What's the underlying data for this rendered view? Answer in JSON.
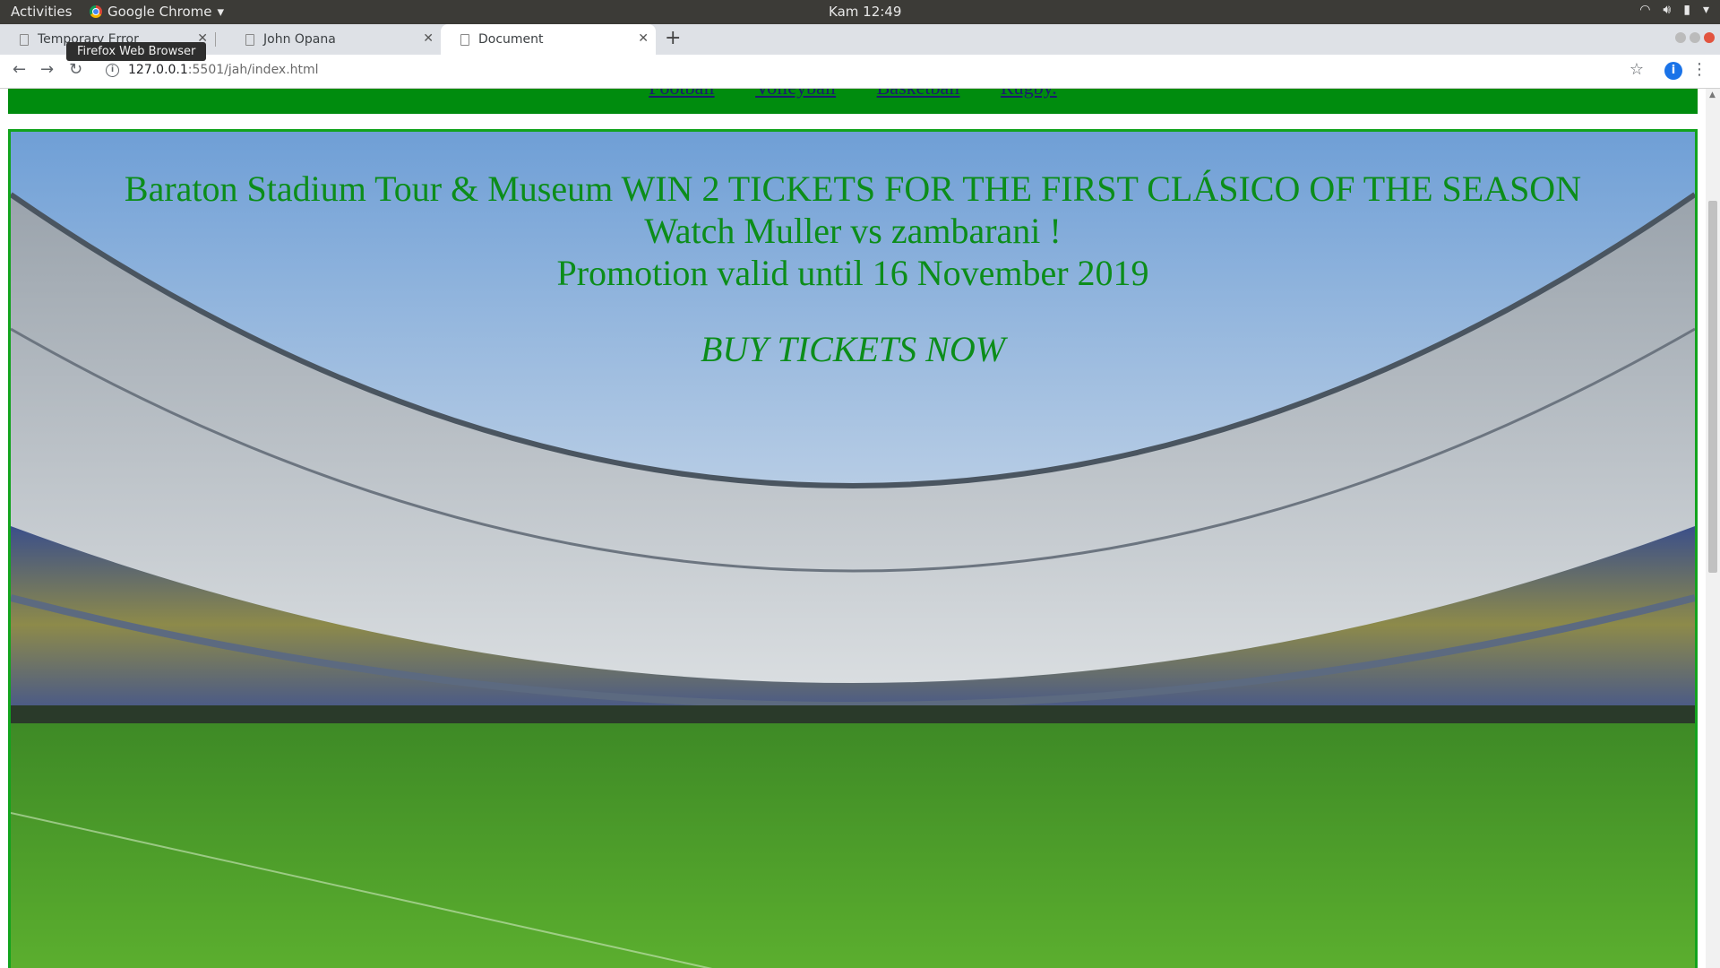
{
  "topbar": {
    "activities": "Activities",
    "app_name": "Google Chrome",
    "clock": "Kam 12:49"
  },
  "tabs": [
    {
      "title": "Temporary Error",
      "active": false
    },
    {
      "title": "John Opana",
      "active": false
    },
    {
      "title": "Document",
      "active": true
    }
  ],
  "tooltip": "Firefox Web Browser",
  "toolbar": {
    "url_host": "127.0.0.1",
    "url_rest": ":5501/jah/index.html",
    "extension_badge": "i"
  },
  "nav": {
    "links": [
      "Football",
      "Volleyball",
      "Basketball",
      "Rugby."
    ]
  },
  "hero": {
    "line1": "Baraton Stadium Tour & Museum WIN 2 TICKETS FOR THE FIRST CLÁSICO OF THE SEASON",
    "line2": "Watch Muller vs zambarani !",
    "line3": "Promotion valid until 16 November 2019",
    "cta": "BUY TICKETS NOW",
    "text_color": "#0c8d1a",
    "border_color": "#12a31d"
  },
  "colors": {
    "nav_band": "#008c0e",
    "ubuntu_bar": "#3c3b37",
    "tab_strip": "#dee1e6"
  }
}
